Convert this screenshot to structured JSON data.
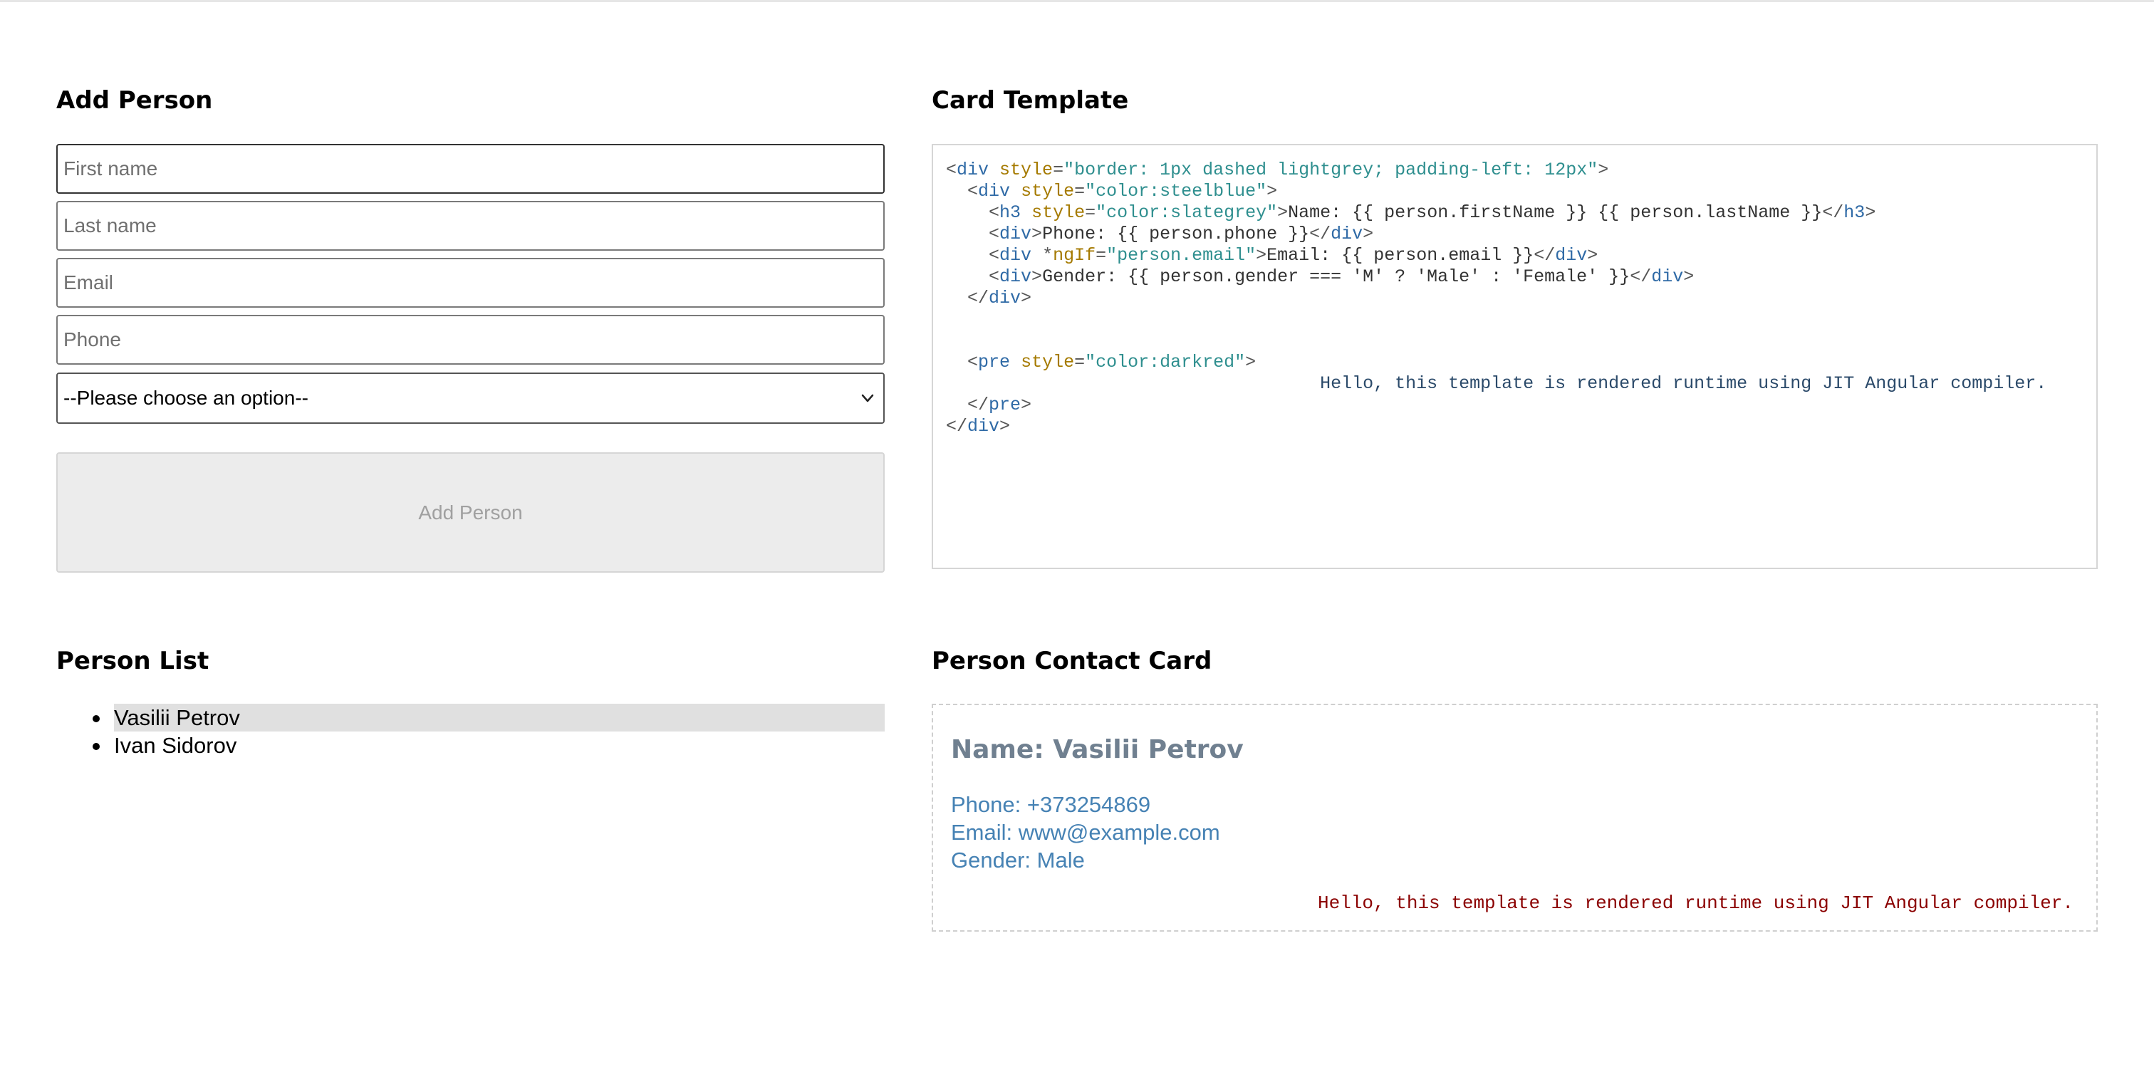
{
  "add_person": {
    "title": "Add Person",
    "first_name_placeholder": "First name",
    "last_name_placeholder": "Last name",
    "email_placeholder": "Email",
    "phone_placeholder": "Phone",
    "gender_select_value": "--Please choose an option--",
    "add_button_label": "Add Person"
  },
  "card_template": {
    "title": "Card Template",
    "lines": [
      "<div style=\"border: 1px dashed lightgrey; padding-left: 12px\">",
      "  <div style=\"color:steelblue\">",
      "    <h3 style=\"color:slategrey\">Name: {{ person.firstName }} {{ person.lastName }}</h3>",
      "    <div>Phone: {{ person.phone }}</div>",
      "    <div *ngIf=\"person.email\">Email: {{ person.email }}</div>",
      "    <div>Gender: {{ person.gender === 'M' ? 'Male' : 'Female' }}</div>",
      "  </div>",
      "",
      "",
      "  <pre style=\"color:darkred\">",
      "                                   Hello, this template is rendered runtime using JIT Angular compiler.",
      "  </pre>",
      "</div>"
    ]
  },
  "person_list": {
    "title": "Person List",
    "items": [
      "Vasilii Petrov",
      "Ivan Sidorov"
    ],
    "selected_index": 0
  },
  "contact_card": {
    "title": "Person Contact Card",
    "name_line": "Name: Vasilii Petrov",
    "phone_line": "Phone: +373254869",
    "email_line": "Email: www@example.com",
    "gender_line": "Gender: Male",
    "pre_text": "Hello, this template is rendered runtime using JIT Angular compiler."
  },
  "colors": {
    "name_color": "#708090",
    "body_color": "#4682b4",
    "pre_color": "#8b0000",
    "selected_bg": "#e0e0e0"
  }
}
